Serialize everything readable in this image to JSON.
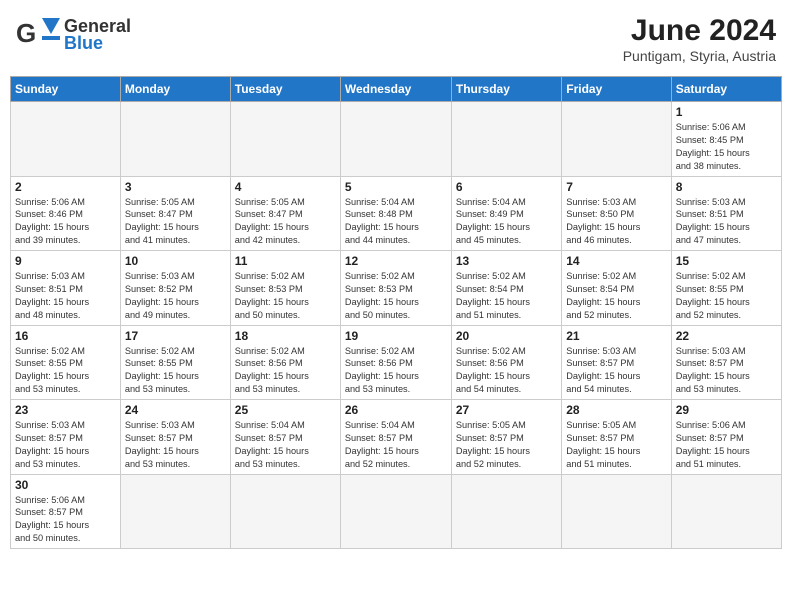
{
  "header": {
    "logo_general": "General",
    "logo_blue": "Blue",
    "month_title": "June 2024",
    "subtitle": "Puntigam, Styria, Austria"
  },
  "days_of_week": [
    "Sunday",
    "Monday",
    "Tuesday",
    "Wednesday",
    "Thursday",
    "Friday",
    "Saturday"
  ],
  "weeks": [
    [
      {
        "day": "",
        "info": ""
      },
      {
        "day": "",
        "info": ""
      },
      {
        "day": "",
        "info": ""
      },
      {
        "day": "",
        "info": ""
      },
      {
        "day": "",
        "info": ""
      },
      {
        "day": "",
        "info": ""
      },
      {
        "day": "1",
        "info": "Sunrise: 5:06 AM\nSunset: 8:45 PM\nDaylight: 15 hours\nand 38 minutes."
      }
    ],
    [
      {
        "day": "2",
        "info": "Sunrise: 5:06 AM\nSunset: 8:46 PM\nDaylight: 15 hours\nand 39 minutes."
      },
      {
        "day": "3",
        "info": "Sunrise: 5:05 AM\nSunset: 8:47 PM\nDaylight: 15 hours\nand 41 minutes."
      },
      {
        "day": "4",
        "info": "Sunrise: 5:05 AM\nSunset: 8:47 PM\nDaylight: 15 hours\nand 42 minutes."
      },
      {
        "day": "5",
        "info": "Sunrise: 5:04 AM\nSunset: 8:48 PM\nDaylight: 15 hours\nand 44 minutes."
      },
      {
        "day": "6",
        "info": "Sunrise: 5:04 AM\nSunset: 8:49 PM\nDaylight: 15 hours\nand 45 minutes."
      },
      {
        "day": "7",
        "info": "Sunrise: 5:03 AM\nSunset: 8:50 PM\nDaylight: 15 hours\nand 46 minutes."
      },
      {
        "day": "8",
        "info": "Sunrise: 5:03 AM\nSunset: 8:51 PM\nDaylight: 15 hours\nand 47 minutes."
      }
    ],
    [
      {
        "day": "9",
        "info": "Sunrise: 5:03 AM\nSunset: 8:51 PM\nDaylight: 15 hours\nand 48 minutes."
      },
      {
        "day": "10",
        "info": "Sunrise: 5:03 AM\nSunset: 8:52 PM\nDaylight: 15 hours\nand 49 minutes."
      },
      {
        "day": "11",
        "info": "Sunrise: 5:02 AM\nSunset: 8:53 PM\nDaylight: 15 hours\nand 50 minutes."
      },
      {
        "day": "12",
        "info": "Sunrise: 5:02 AM\nSunset: 8:53 PM\nDaylight: 15 hours\nand 50 minutes."
      },
      {
        "day": "13",
        "info": "Sunrise: 5:02 AM\nSunset: 8:54 PM\nDaylight: 15 hours\nand 51 minutes."
      },
      {
        "day": "14",
        "info": "Sunrise: 5:02 AM\nSunset: 8:54 PM\nDaylight: 15 hours\nand 52 minutes."
      },
      {
        "day": "15",
        "info": "Sunrise: 5:02 AM\nSunset: 8:55 PM\nDaylight: 15 hours\nand 52 minutes."
      }
    ],
    [
      {
        "day": "16",
        "info": "Sunrise: 5:02 AM\nSunset: 8:55 PM\nDaylight: 15 hours\nand 53 minutes."
      },
      {
        "day": "17",
        "info": "Sunrise: 5:02 AM\nSunset: 8:55 PM\nDaylight: 15 hours\nand 53 minutes."
      },
      {
        "day": "18",
        "info": "Sunrise: 5:02 AM\nSunset: 8:56 PM\nDaylight: 15 hours\nand 53 minutes."
      },
      {
        "day": "19",
        "info": "Sunrise: 5:02 AM\nSunset: 8:56 PM\nDaylight: 15 hours\nand 53 minutes."
      },
      {
        "day": "20",
        "info": "Sunrise: 5:02 AM\nSunset: 8:56 PM\nDaylight: 15 hours\nand 54 minutes."
      },
      {
        "day": "21",
        "info": "Sunrise: 5:03 AM\nSunset: 8:57 PM\nDaylight: 15 hours\nand 54 minutes."
      },
      {
        "day": "22",
        "info": "Sunrise: 5:03 AM\nSunset: 8:57 PM\nDaylight: 15 hours\nand 53 minutes."
      }
    ],
    [
      {
        "day": "23",
        "info": "Sunrise: 5:03 AM\nSunset: 8:57 PM\nDaylight: 15 hours\nand 53 minutes."
      },
      {
        "day": "24",
        "info": "Sunrise: 5:03 AM\nSunset: 8:57 PM\nDaylight: 15 hours\nand 53 minutes."
      },
      {
        "day": "25",
        "info": "Sunrise: 5:04 AM\nSunset: 8:57 PM\nDaylight: 15 hours\nand 53 minutes."
      },
      {
        "day": "26",
        "info": "Sunrise: 5:04 AM\nSunset: 8:57 PM\nDaylight: 15 hours\nand 52 minutes."
      },
      {
        "day": "27",
        "info": "Sunrise: 5:05 AM\nSunset: 8:57 PM\nDaylight: 15 hours\nand 52 minutes."
      },
      {
        "day": "28",
        "info": "Sunrise: 5:05 AM\nSunset: 8:57 PM\nDaylight: 15 hours\nand 51 minutes."
      },
      {
        "day": "29",
        "info": "Sunrise: 5:06 AM\nSunset: 8:57 PM\nDaylight: 15 hours\nand 51 minutes."
      }
    ],
    [
      {
        "day": "30",
        "info": "Sunrise: 5:06 AM\nSunset: 8:57 PM\nDaylight: 15 hours\nand 50 minutes."
      },
      {
        "day": "",
        "info": ""
      },
      {
        "day": "",
        "info": ""
      },
      {
        "day": "",
        "info": ""
      },
      {
        "day": "",
        "info": ""
      },
      {
        "day": "",
        "info": ""
      },
      {
        "day": "",
        "info": ""
      }
    ]
  ]
}
